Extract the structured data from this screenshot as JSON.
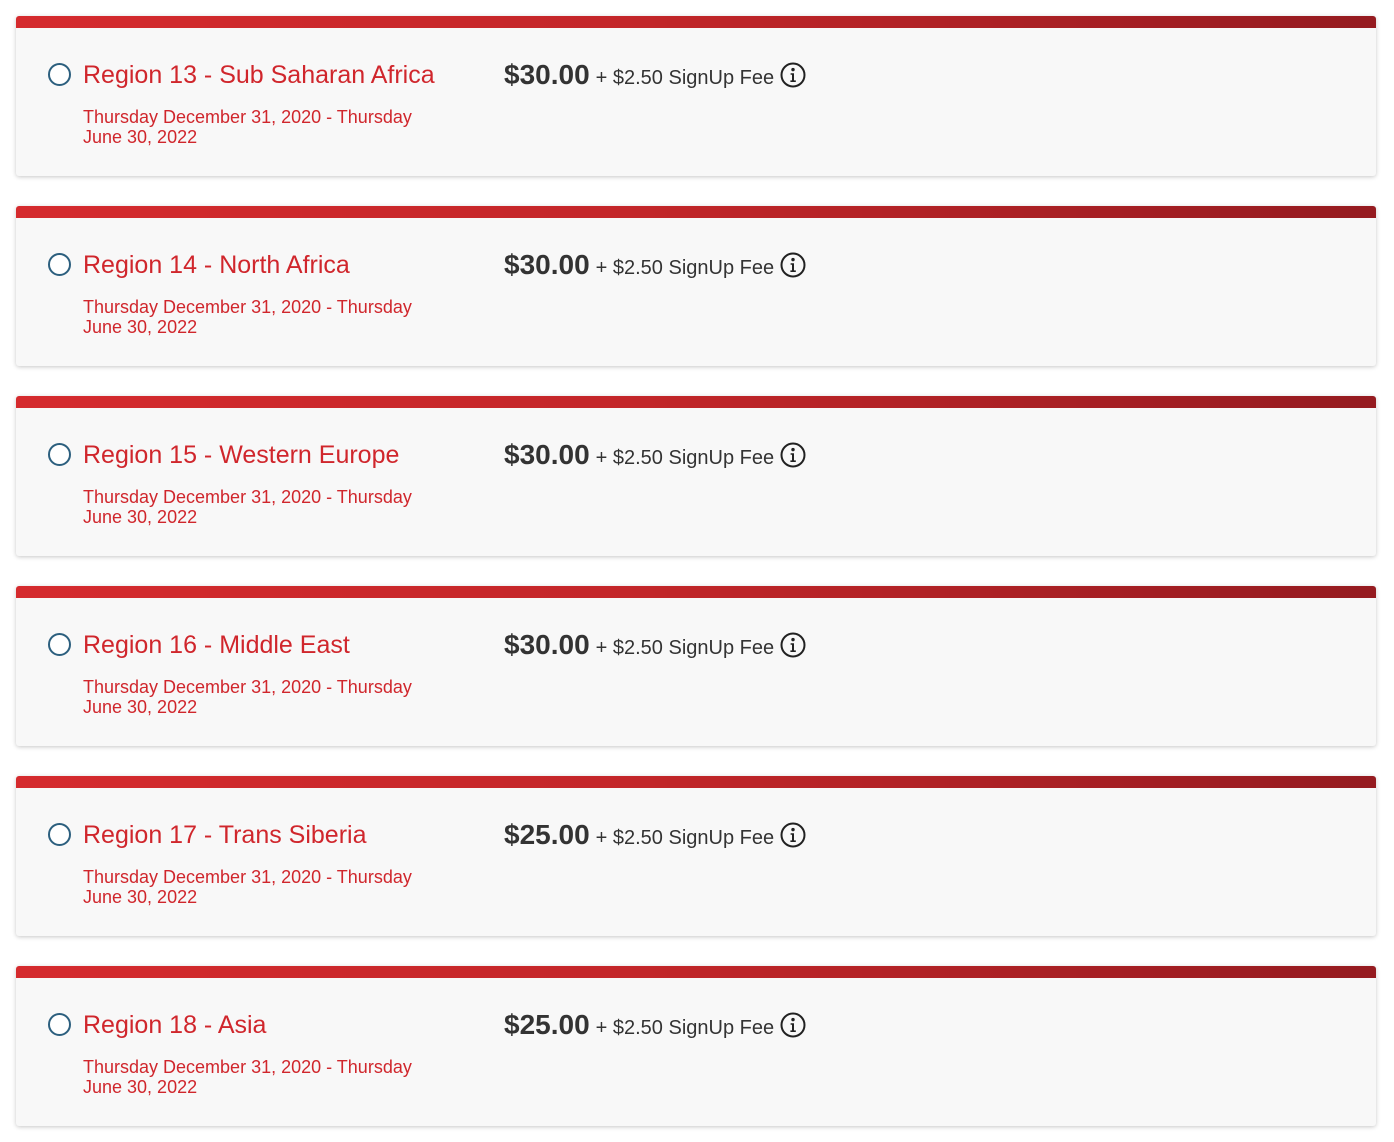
{
  "cards": [
    {
      "title": "Region 13 - Sub Saharan Africa",
      "dates": "Thursday December 31, 2020 - Thursday June 30, 2022",
      "price": "$30.00",
      "fee": "+ $2.50 SignUp Fee"
    },
    {
      "title": "Region 14 - North Africa",
      "dates": "Thursday December 31, 2020 - Thursday June 30, 2022",
      "price": "$30.00",
      "fee": "+ $2.50 SignUp Fee"
    },
    {
      "title": "Region 15 - Western Europe",
      "dates": "Thursday December 31, 2020 - Thursday June 30, 2022",
      "price": "$30.00",
      "fee": "+ $2.50 SignUp Fee"
    },
    {
      "title": "Region 16 - Middle East",
      "dates": "Thursday December 31, 2020 - Thursday June 30, 2022",
      "price": "$30.00",
      "fee": "+ $2.50 SignUp Fee"
    },
    {
      "title": "Region 17 - Trans Siberia",
      "dates": "Thursday December 31, 2020 - Thursday June 30, 2022",
      "price": "$25.00",
      "fee": "+ $2.50 SignUp Fee"
    },
    {
      "title": "Region 18 - Asia",
      "dates": "Thursday December 31, 2020 - Thursday June 30, 2022",
      "price": "$25.00",
      "fee": "+ $2.50 SignUp Fee"
    }
  ],
  "icons": {
    "radio": "radio-unchecked-icon",
    "info": "info-circle-icon"
  },
  "colors": {
    "accent_red": "#d0262c",
    "bar_start": "#d52b2e",
    "bar_end": "#951b20",
    "radio_border": "#2c5f7e",
    "text_dark": "#333333",
    "card_bg": "#f8f8f8"
  }
}
